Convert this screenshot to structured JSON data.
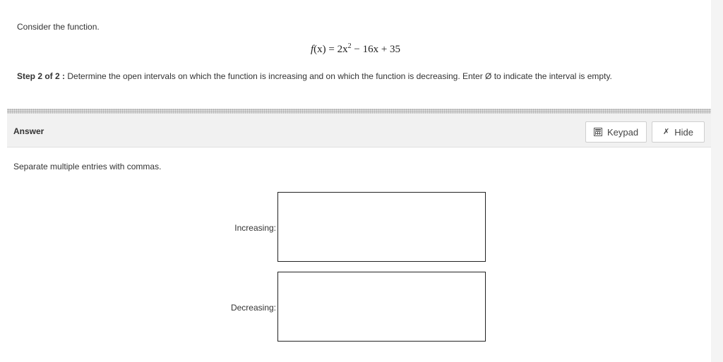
{
  "question": {
    "intro": "Consider the function.",
    "equation": {
      "lhs_func": "f",
      "lhs_var": "(x)",
      "equals": " = ",
      "term1": "2x",
      "term1_exp": "2",
      "rest": " − 16x + 35"
    },
    "step_prefix": "Step 2 of 2 :",
    "step_text": " Determine the open intervals on which the function is increasing and on which the function is decreasing. Enter Ø to indicate the interval is empty."
  },
  "answer": {
    "label": "Answer",
    "keypad_label": "Keypad",
    "hide_label": "Hide",
    "instructions": "Separate multiple entries with commas.",
    "increasing_label": "Increasing:",
    "increasing_value": "",
    "decreasing_label": "Decreasing:",
    "decreasing_value": ""
  },
  "icons": {
    "keypad": "calculator-icon",
    "hide": "pin-icon"
  }
}
